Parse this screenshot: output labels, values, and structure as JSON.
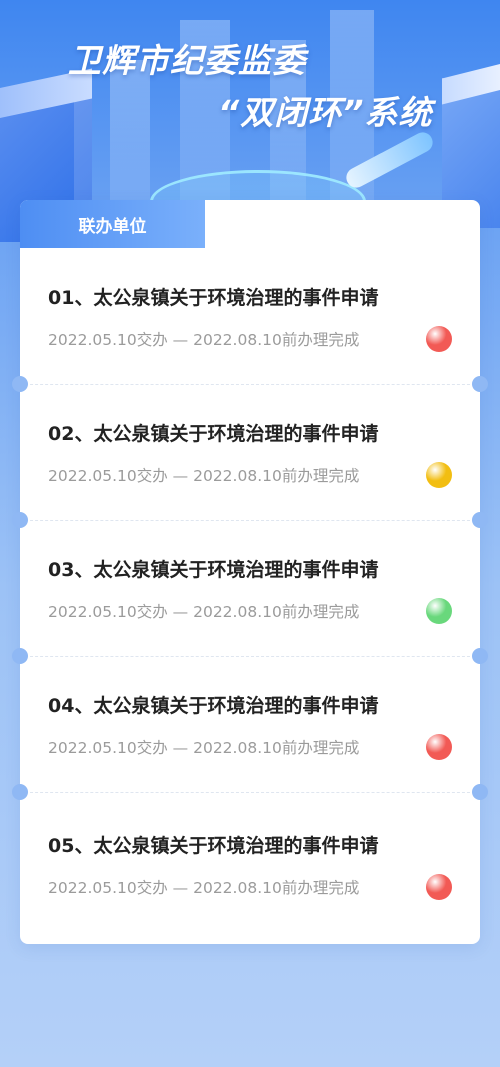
{
  "header": {
    "title_line1": "卫辉市纪委监委",
    "title_line2": "“双闭环”系统"
  },
  "section_label": "联办单位",
  "colors": {
    "red": "#f25a55",
    "yellow": "#f2be12",
    "green": "#69d87c"
  },
  "items": [
    {
      "title": "01、太公泉镇关于环境治理的事件申请",
      "meta": "2022.05.10交办  —  2022.08.10前办理完成",
      "status": "red"
    },
    {
      "title": "02、太公泉镇关于环境治理的事件申请",
      "meta": "2022.05.10交办  —  2022.08.10前办理完成",
      "status": "yellow"
    },
    {
      "title": "03、太公泉镇关于环境治理的事件申请",
      "meta": "2022.05.10交办  —  2022.08.10前办理完成",
      "status": "green"
    },
    {
      "title": "04、太公泉镇关于环境治理的事件申请",
      "meta": "2022.05.10交办  —  2022.08.10前办理完成",
      "status": "red"
    },
    {
      "title": "05、太公泉镇关于环境治理的事件申请",
      "meta": "2022.05.10交办  —  2022.08.10前办理完成",
      "status": "red"
    }
  ]
}
